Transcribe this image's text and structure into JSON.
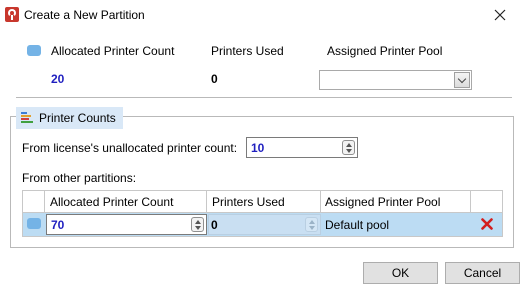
{
  "window": {
    "title": "Create a New Partition"
  },
  "top": {
    "col_allocated": "Allocated Printer Count",
    "col_used": "Printers Used",
    "col_pool": "Assigned Printer Pool",
    "allocated_value": "20",
    "used_value": "0",
    "pool_value": ""
  },
  "group": {
    "title": "Printer Counts",
    "license_label": "From license's unallocated printer count:",
    "license_value": "10",
    "other_label": "From other partitions:",
    "grid": {
      "headers": [
        "Allocated Printer Count",
        "Printers Used",
        "Assigned Printer Pool"
      ],
      "rows": [
        {
          "allocated": "70",
          "used": "0",
          "pool": "Default pool"
        }
      ]
    }
  },
  "buttons": {
    "ok": "OK",
    "cancel": "Cancel"
  },
  "colors": {
    "swatch": "#74b3e6",
    "value_blue": "#1f1fbf",
    "selected_row": "#bcdcf3",
    "delete_red": "#d21e1e",
    "group_header": "#d9e8f7"
  },
  "icons": {
    "app": "printer-app-icon",
    "close": "close-icon",
    "group": "bar-chart-icon",
    "delete": "delete-x-icon"
  }
}
